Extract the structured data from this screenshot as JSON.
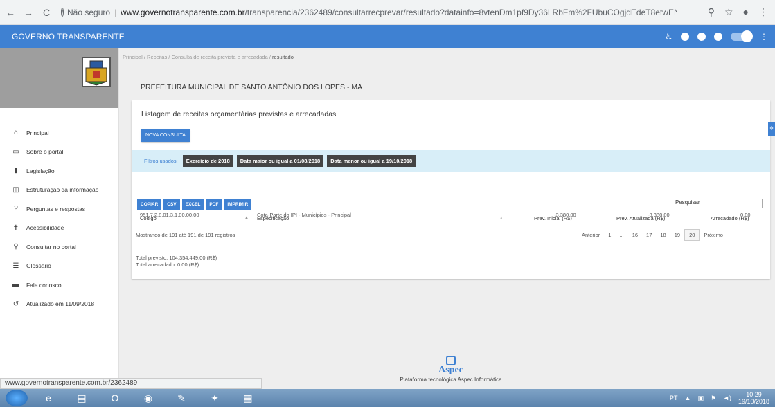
{
  "browser": {
    "security_label": "Não seguro",
    "url_domain": "www.governotransparente.com.br",
    "url_path": "/transparencia/2362489/consultarrecprevar/resultado?datainfo=8vtenDm1pf9Dy36LRbFm%2FUbuCOgjdEdeT8etwENYYCI%..."
  },
  "header": {
    "title": "GOVERNO TRANSPARENTE"
  },
  "sidebar": {
    "items": [
      {
        "label": "Principal",
        "icon": "home-icon"
      },
      {
        "label": "Sobre o portal",
        "icon": "folder-icon"
      },
      {
        "label": "Legislação",
        "icon": "document-icon"
      },
      {
        "label": "Estruturação da informação",
        "icon": "layers-icon"
      },
      {
        "label": "Perguntas e respostas",
        "icon": "question-icon"
      },
      {
        "label": "Acessibilidade",
        "icon": "accessibility-icon"
      },
      {
        "label": "Consultar no portal",
        "icon": "search-icon"
      },
      {
        "label": "Glossário",
        "icon": "list-icon"
      },
      {
        "label": "Fale conosco",
        "icon": "chat-icon"
      },
      {
        "label": "Atualizado em 11/09/2018",
        "icon": "history-icon"
      }
    ]
  },
  "breadcrumb": {
    "principal": "Principal",
    "receitas": "Receitas",
    "consulta": "Consulta de receita prevista e arrecadada",
    "current": "resultado",
    "sep": "/"
  },
  "page": {
    "org_title": "PREFEITURA MUNICIPAL DE SANTO ANTÔNIO DOS LOPES - MA",
    "card_title": "Listagem de receitas orçamentárias previstas e arrecadadas",
    "new_query_button": "NOVA CONSULTA"
  },
  "filters": {
    "label": "Filtros usados:",
    "chips": [
      "Exercício de 2018",
      "Data maior ou igual a 01/08/2018",
      "Data menor ou igual a 19/10/2018"
    ]
  },
  "toolbar": {
    "buttons": [
      "COPIAR",
      "CSV",
      "EXCEL",
      "PDF",
      "IMPRIMIR"
    ],
    "search_label": "Pesquisar"
  },
  "table": {
    "headers": [
      "Código",
      "Especificação",
      "Prev. Inicial (R$)",
      "Prev. Atualizada (R$)",
      "Arrecadado (R$)"
    ],
    "rows": [
      {
        "codigo": "951.7.2.8.01.3.1.00.00.00",
        "especificacao": "Cota-Parte do IPI - Municípios - Principal",
        "prev_inicial": "-3.380,00",
        "prev_atualizada": "-3.380,00",
        "arrecadado": "0,00"
      }
    ]
  },
  "table_info": "Mostrando de 191 até 191 de 191 registros",
  "pagination": {
    "previous": "Anterior",
    "pages": [
      "1",
      "...",
      "16",
      "17",
      "18",
      "19",
      "20"
    ],
    "active": "20",
    "next": "Próximo"
  },
  "totals": {
    "previsto": "Total previsto: 104.354.449,00 (R$)",
    "arrecadado": "Total arrecadado: 0,00 (R$)"
  },
  "footer": {
    "brand": "Aspec",
    "text": "Plataforma tecnológica Aspec Informática"
  },
  "status_bar_url": "www.governotransparente.com.br/2362489",
  "taskbar": {
    "lang": "PT",
    "time": "10:29",
    "date": "19/10/2018"
  }
}
